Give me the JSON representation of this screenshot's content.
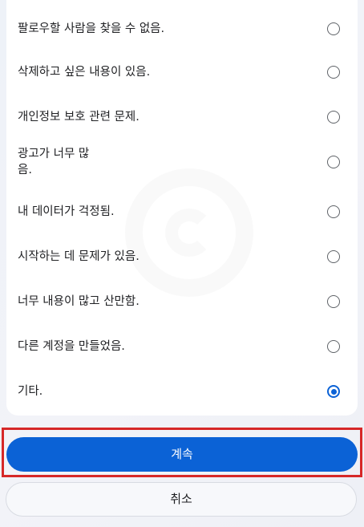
{
  "options": [
    {
      "label": "팔로우할 사람을 찾을 수 없음.",
      "selected": false
    },
    {
      "label": "삭제하고 싶은 내용이 있음.",
      "selected": false
    },
    {
      "label": "개인정보 보호 관련 문제.",
      "selected": false
    },
    {
      "label": "광고가 너무 많\n음.",
      "selected": false
    },
    {
      "label": "내 데이터가 걱정됨.",
      "selected": false
    },
    {
      "label": "시작하는 데 문제가 있음.",
      "selected": false
    },
    {
      "label": "너무 내용이 많고 산만함.",
      "selected": false
    },
    {
      "label": "다른 계정을 만들었음.",
      "selected": false
    },
    {
      "label": "기타.",
      "selected": true
    }
  ],
  "buttons": {
    "continue_label": "계속",
    "cancel_label": "취소"
  },
  "colors": {
    "accent": "#0b62d6",
    "highlight": "#d62828"
  }
}
